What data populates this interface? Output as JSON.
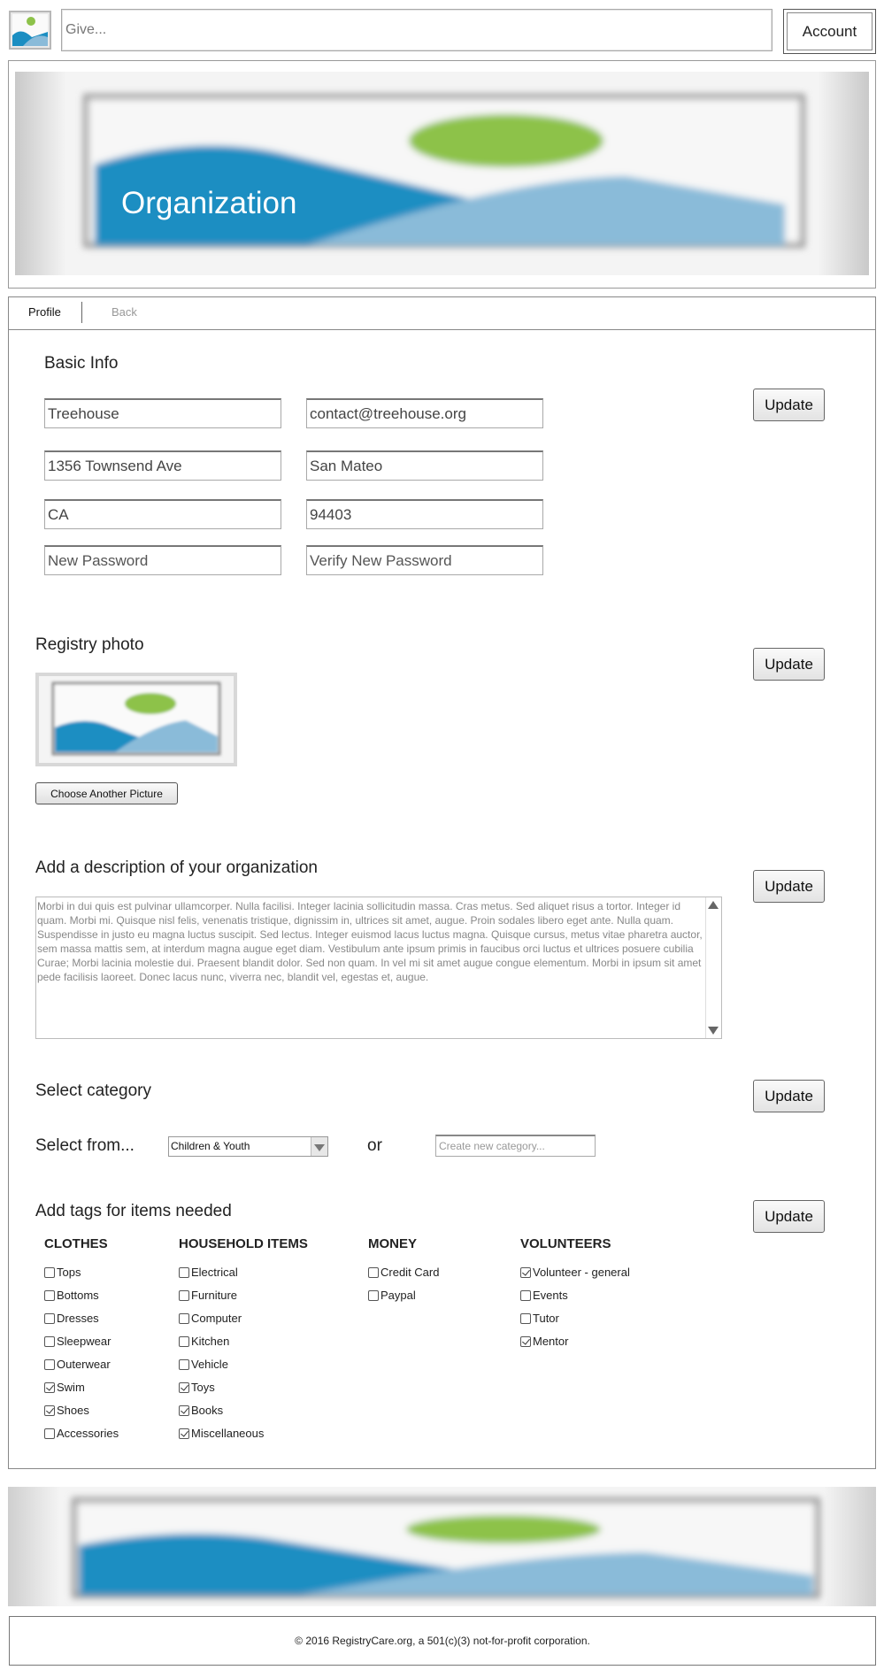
{
  "topbar": {
    "search_placeholder": "Give...",
    "account_label": "Account"
  },
  "banner": {
    "title": "Organization"
  },
  "tabs": {
    "profile": "Profile",
    "back": "Back"
  },
  "basic_info": {
    "heading": "Basic Info",
    "name": "Treehouse",
    "email": "contact@treehouse.org",
    "address": "1356 Townsend Ave",
    "city": "San Mateo",
    "state": "CA",
    "zip": "94403",
    "new_password_placeholder": "New Password",
    "verify_password_placeholder": "Verify New Password",
    "update_label": "Update"
  },
  "registry_photo": {
    "heading": "Registry photo",
    "choose_label": "Choose Another Picture",
    "update_label": "Update"
  },
  "description": {
    "heading": "Add a description of your organization",
    "text": "Morbi in dui quis est pulvinar ullamcorper. Nulla facilisi. Integer lacinia sollicitudin massa. Cras metus. Sed aliquet risus a tortor. Integer id quam. Morbi mi. Quisque nisl felis, venenatis tristique, dignissim in, ultrices sit amet, augue. Proin sodales libero eget ante. Nulla quam. Suspendisse in justo eu magna luctus suscipit. Sed lectus. Integer euismod lacus luctus magna. Quisque cursus, metus vitae pharetra auctor, sem massa mattis sem, at interdum magna augue eget diam. Vestibulum ante ipsum primis in faucibus orci luctus et ultrices posuere cubilia Curae; Morbi lacinia molestie dui. Praesent blandit dolor. Sed non quam. In vel mi sit amet augue congue elementum. Morbi in ipsum sit amet pede facilisis laoreet. Donec lacus nunc, viverra nec, blandit vel, egestas et, augue.",
    "update_label": "Update"
  },
  "category": {
    "heading": "Select category",
    "select_label": "Select from...",
    "selected": "Children & Youth",
    "or_label": "or",
    "new_placeholder": "Create new category...",
    "update_label": "Update"
  },
  "tags": {
    "heading": "Add tags for items needed",
    "update_label": "Update",
    "columns": [
      {
        "title": "CLOTHES",
        "items": [
          {
            "label": "Tops",
            "checked": false
          },
          {
            "label": "Bottoms",
            "checked": false
          },
          {
            "label": "Dresses",
            "checked": false
          },
          {
            "label": "Sleepwear",
            "checked": false
          },
          {
            "label": "Outerwear",
            "checked": false
          },
          {
            "label": "Swim",
            "checked": true
          },
          {
            "label": "Shoes",
            "checked": true
          },
          {
            "label": "Accessories",
            "checked": false
          }
        ]
      },
      {
        "title": "HOUSEHOLD ITEMS",
        "items": [
          {
            "label": "Electrical",
            "checked": false
          },
          {
            "label": "Furniture",
            "checked": false
          },
          {
            "label": "Computer",
            "checked": false
          },
          {
            "label": "Kitchen",
            "checked": false
          },
          {
            "label": "Vehicle",
            "checked": false
          },
          {
            "label": "Toys",
            "checked": true
          },
          {
            "label": "Books",
            "checked": true
          },
          {
            "label": "Miscellaneous",
            "checked": true
          }
        ]
      },
      {
        "title": "MONEY",
        "items": [
          {
            "label": "Credit Card",
            "checked": false
          },
          {
            "label": "Paypal",
            "checked": false
          }
        ]
      },
      {
        "title": "VOLUNTEERS",
        "items": [
          {
            "label": "Volunteer - general",
            "checked": true
          },
          {
            "label": "Events",
            "checked": false
          },
          {
            "label": "Tutor",
            "checked": false
          },
          {
            "label": "Mentor",
            "checked": true
          }
        ]
      }
    ]
  },
  "footer": {
    "text": "© 2016 RegistryCare.org, a 501(c)(3) not-for-profit corporation."
  },
  "colors": {
    "image_blue_dark": "#1b8ec2",
    "image_blue_light": "#8abbd9",
    "image_green": "#8dc24a"
  }
}
